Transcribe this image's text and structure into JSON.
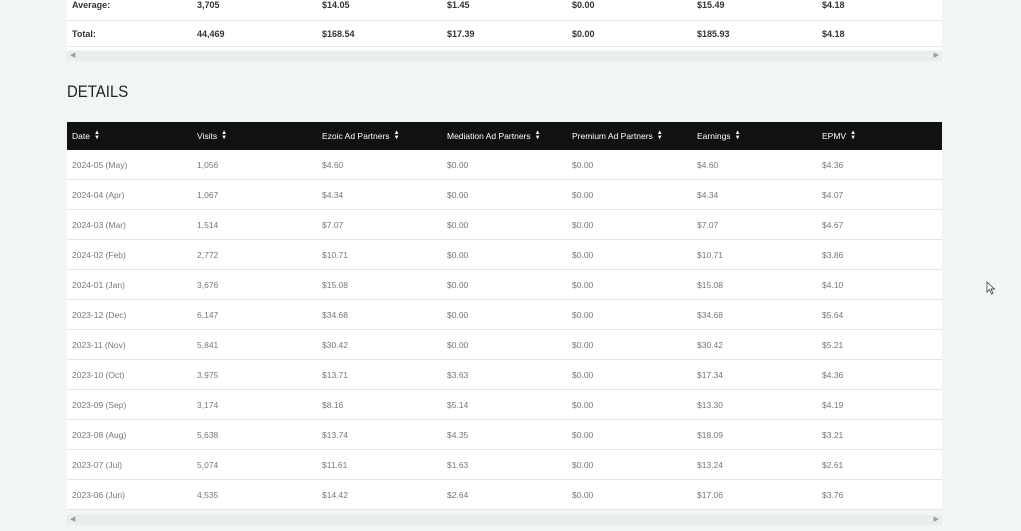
{
  "summary": {
    "rows": [
      {
        "label": "Average:",
        "visits": "3,705",
        "ezoic": "$14.05",
        "mediation": "$1.45",
        "premium": "$0.00",
        "earnings": "$15.49",
        "epmv": "$4.18"
      },
      {
        "label": "Total:",
        "visits": "44,469",
        "ezoic": "$168.54",
        "mediation": "$17.39",
        "premium": "$0.00",
        "earnings": "$185.93",
        "epmv": "$4.18"
      }
    ]
  },
  "details": {
    "title": "DETAILS",
    "columns": [
      "Date",
      "Visits",
      "Ezoic Ad Partners",
      "Mediation Ad Partners",
      "Premium Ad Partners",
      "Earnings",
      "EPMV"
    ],
    "rows": [
      [
        "2024-05 (May)",
        "1,056",
        "$4.60",
        "$0.00",
        "$0.00",
        "$4.60",
        "$4.36"
      ],
      [
        "2024-04 (Apr)",
        "1,067",
        "$4.34",
        "$0.00",
        "$0.00",
        "$4.34",
        "$4.07"
      ],
      [
        "2024-03 (Mar)",
        "1,514",
        "$7.07",
        "$0.00",
        "$0.00",
        "$7.07",
        "$4.67"
      ],
      [
        "2024-02 (Feb)",
        "2,772",
        "$10.71",
        "$0.00",
        "$0.00",
        "$10.71",
        "$3.86"
      ],
      [
        "2024-01 (Jan)",
        "3,676",
        "$15.08",
        "$0.00",
        "$0.00",
        "$15.08",
        "$4.10"
      ],
      [
        "2023-12 (Dec)",
        "6,147",
        "$34.68",
        "$0.00",
        "$0.00",
        "$34.68",
        "$5.64"
      ],
      [
        "2023-11 (Nov)",
        "5,841",
        "$30.42",
        "$0.00",
        "$0.00",
        "$30.42",
        "$5.21"
      ],
      [
        "2023-10 (Oct)",
        "3,975",
        "$13.71",
        "$3.63",
        "$0.00",
        "$17.34",
        "$4.36"
      ],
      [
        "2023-09 (Sep)",
        "3,174",
        "$8.16",
        "$5.14",
        "$0.00",
        "$13.30",
        "$4.19"
      ],
      [
        "2023-08 (Aug)",
        "5,638",
        "$13.74",
        "$4.35",
        "$0.00",
        "$18.09",
        "$3.21"
      ],
      [
        "2023-07 (Jul)",
        "5,074",
        "$11.61",
        "$1.63",
        "$0.00",
        "$13.24",
        "$2.61"
      ],
      [
        "2023-06 (Jun)",
        "4,535",
        "$14.42",
        "$2.64",
        "$0.00",
        "$17.06",
        "$3.76"
      ]
    ]
  },
  "icons": {
    "sort": "sort-icon",
    "scroll_left": "scroll-left-arrow-icon",
    "scroll_right": "scroll-right-arrow-icon",
    "cursor": "mouse-pointer-icon"
  }
}
